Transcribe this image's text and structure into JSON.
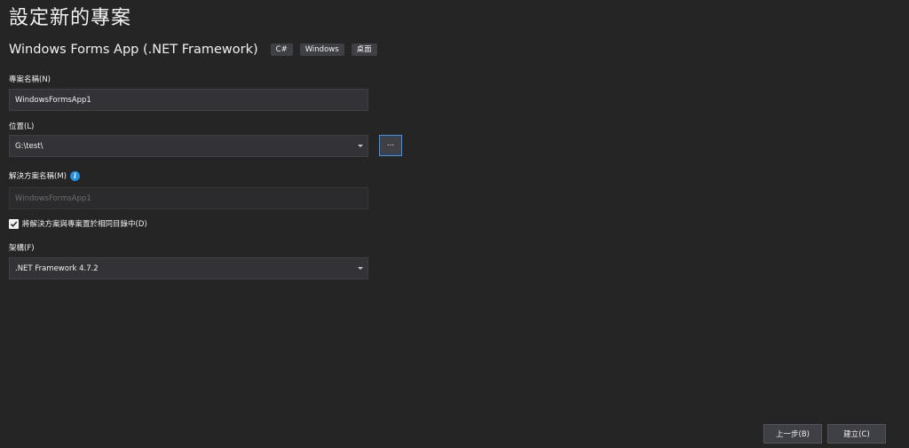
{
  "page": {
    "title": "設定新的專案"
  },
  "template": {
    "name": "Windows Forms App (.NET Framework)",
    "tags": [
      "C#",
      "Windows",
      "桌面"
    ]
  },
  "project_name": {
    "label": "專案名稱(N)",
    "value": "WindowsFormsApp1"
  },
  "location": {
    "label": "位置(L)",
    "value": "G:\\test\\",
    "browse_label": "..."
  },
  "solution_name": {
    "label": "解決方案名稱(M)",
    "placeholder": "WindowsFormsApp1",
    "info_icon": "info-icon"
  },
  "same_directory": {
    "label": "將解決方案與專案置於相同目錄中(D)",
    "checked": true
  },
  "framework": {
    "label": "架構(F)",
    "value": ".NET Framework 4.7.2"
  },
  "footer": {
    "back_label": "上一步(B)",
    "create_label": "建立(C)"
  },
  "colors": {
    "background": "#252526",
    "input_bg": "#333337",
    "accent": "#3399ff",
    "info": "#1e90e8"
  }
}
